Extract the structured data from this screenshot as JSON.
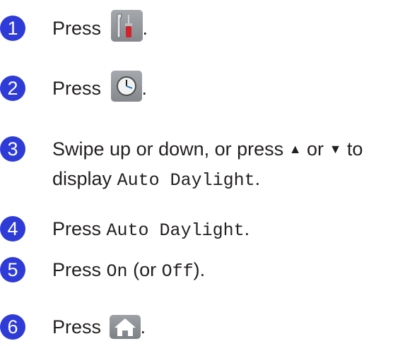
{
  "step_colors": {
    "badge": "#2e3bd6"
  },
  "steps": [
    {
      "num": "1",
      "press": "Press",
      "icon": "settings-tools-icon",
      "end": "."
    },
    {
      "num": "2",
      "press": "Press",
      "icon": "clock-icon",
      "end": "."
    },
    {
      "num": "3",
      "line1_a": "Swipe up or down, or press",
      "up": "▲",
      "or": "or",
      "down": "▼",
      "to": "to",
      "line2_a": "display",
      "line2_mono": "Auto Daylight",
      "end": "."
    },
    {
      "num": "4",
      "press": "Press",
      "mono": "Auto Daylight",
      "end": "."
    },
    {
      "num": "5",
      "press": "Press",
      "on": "On",
      "paren_open": "(or",
      "off": "Off",
      "paren_close": ")."
    },
    {
      "num": "6",
      "press": "Press",
      "icon": "home-icon",
      "end": "."
    }
  ]
}
